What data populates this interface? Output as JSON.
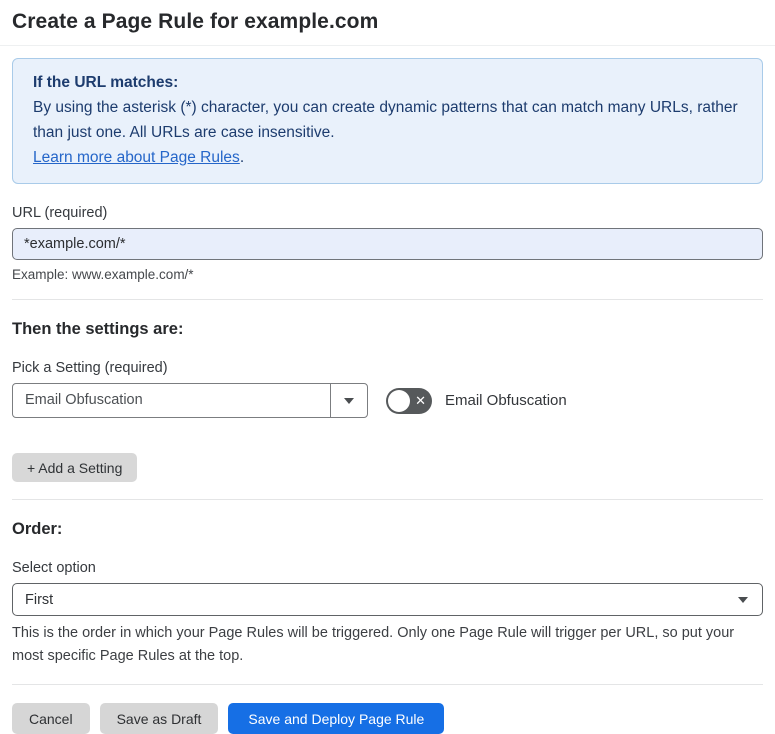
{
  "page": {
    "title": "Create a Page Rule for example.com"
  },
  "info_box": {
    "heading": "If the URL matches:",
    "body": "By using the asterisk (*) character, you can create dynamic patterns that can match many URLs, rather than just one. All URLs are case insensitive.",
    "link_label": "Learn more about Page Rules",
    "link_suffix": "."
  },
  "url_section": {
    "label": "URL (required)",
    "input_value": "*example.com/*",
    "helper": "Example: www.example.com/*"
  },
  "settings_section": {
    "heading": "Then the settings are:",
    "picker_label": "Pick a Setting (required)",
    "picker_value": "Email Obfuscation",
    "toggle_label": "Email Obfuscation",
    "toggle_state": "off",
    "toggle_x_glyph": "✕",
    "add_setting_label": "+ Add a Setting"
  },
  "order_section": {
    "heading": "Order:",
    "select_label": "Select option",
    "select_value": "First",
    "helper": "This is the order in which your Page Rules will be triggered. Only one Page Rule will trigger per URL, so put your most specific Page Rules at the top."
  },
  "footer": {
    "cancel_label": "Cancel",
    "save_draft_label": "Save as Draft",
    "save_deploy_label": "Save and Deploy Page Rule"
  },
  "colors": {
    "info_bg": "#e9f1fb",
    "info_border": "#a9cbe9",
    "info_text": "#1d3c6e",
    "link": "#2566c9",
    "input_bg": "#e8eefb",
    "toggle_off": "#56595b",
    "primary_button": "#166fe5"
  }
}
